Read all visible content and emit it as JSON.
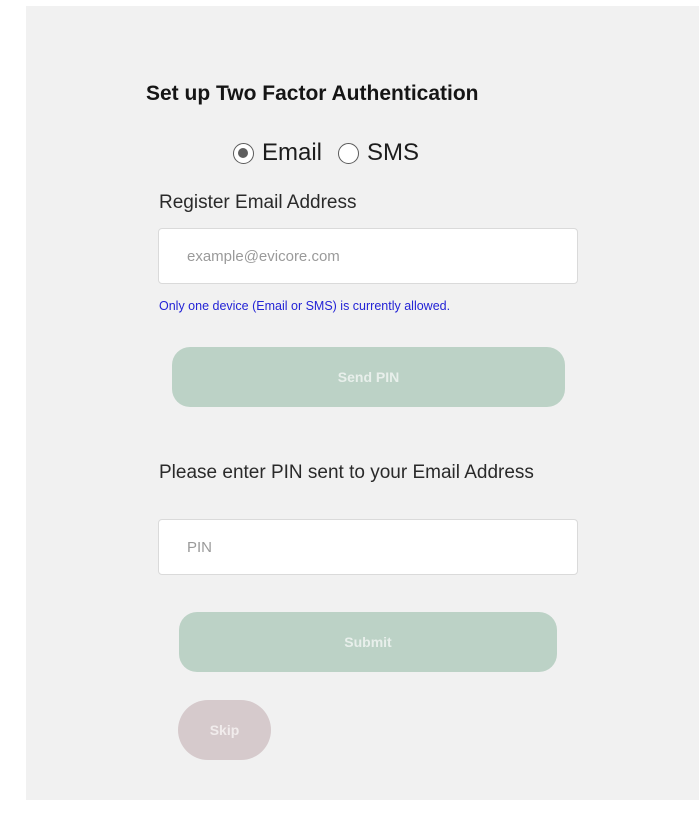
{
  "title": "Set up Two Factor Authentication",
  "method": {
    "options": [
      {
        "label": "Email",
        "checked": true
      },
      {
        "label": "SMS",
        "checked": false
      }
    ]
  },
  "email": {
    "label": "Register Email Address",
    "placeholder": "example@evicore.com",
    "value": ""
  },
  "note": "Only one device (Email or SMS) is currently allowed.",
  "send_pin_label": "Send PIN",
  "pin": {
    "label": "Please enter PIN sent to your Email Address",
    "placeholder": "PIN",
    "value": ""
  },
  "submit_label": "Submit",
  "skip_label": "Skip",
  "colors": {
    "panel_bg": "#f1f1f1",
    "primary_button": "#bcd2c6",
    "skip_button": "#d6cacc",
    "note_text": "#2323d6"
  }
}
